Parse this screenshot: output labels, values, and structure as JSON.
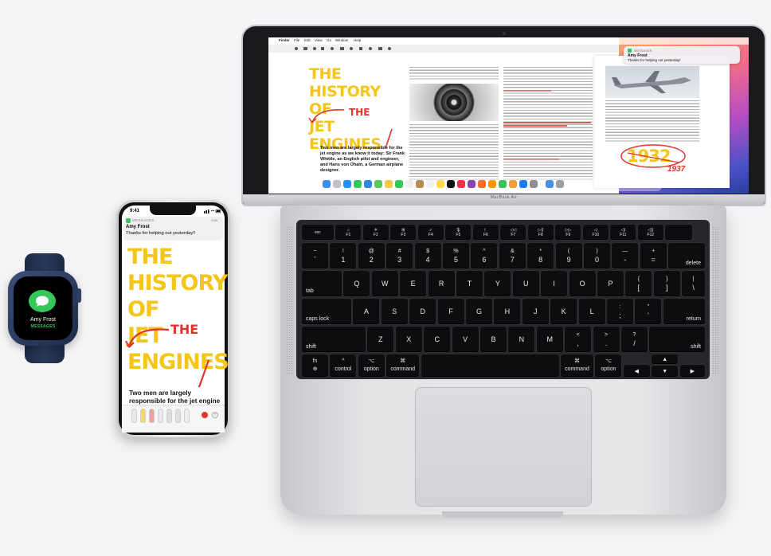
{
  "watch": {
    "contact_name": "Amy Frost",
    "app_label": "MESSAGES",
    "icon": "messages-icon"
  },
  "iphone": {
    "time": "9:41",
    "notification": {
      "app": "MESSAGES",
      "time": "now",
      "sender": "Amy Frost",
      "body": "Thanks for helping out yesterday!!"
    },
    "doc_title_lines": [
      "THE",
      "HISTORY",
      "OF",
      "JET",
      "ENGINES"
    ],
    "annotation": "THE",
    "body_text": "Two men are largely responsible for the jet engine as we know it today: Sir Frank Whittle"
  },
  "macbook": {
    "model_label": "MacBook Air",
    "menubar": [
      "Finder",
      "File",
      "Edit",
      "View",
      "Go",
      "Window",
      "Help"
    ],
    "notification": {
      "app": "MESSAGES",
      "sender": "Amy Frost",
      "body": "Thanks for helping out yesterday!"
    },
    "doc_title_lines": [
      "THE",
      "HISTORY",
      "OF",
      "JET",
      "ENGINES"
    ],
    "doc_annotation": "THE",
    "doc_subtitle": "Two men are largely responsible for the jet engine as we know it today: Sir Frank Whittle, an English pilot and engineer, and Hans von Ohain, a German airplane designer.",
    "year_printed": "1932",
    "year_annotation": "1937",
    "accent_yellow": "#f5c518",
    "accent_red": "#e2342a"
  },
  "keyboard": {
    "row_fn": [
      {
        "top": "esc",
        "bottom": ""
      },
      {
        "top": "☼",
        "bottom": "F1"
      },
      {
        "top": "☀",
        "bottom": "F2"
      },
      {
        "top": "⊞",
        "bottom": "F3"
      },
      {
        "top": "⌕",
        "bottom": "F4"
      },
      {
        "top": "🎙",
        "bottom": "F5"
      },
      {
        "top": "☾",
        "bottom": "F6"
      },
      {
        "top": "◁◁",
        "bottom": "F7"
      },
      {
        "top": "▷||",
        "bottom": "F8"
      },
      {
        "top": "▷▷",
        "bottom": "F9"
      },
      {
        "top": "◁",
        "bottom": "F10"
      },
      {
        "top": "◁)",
        "bottom": "F11"
      },
      {
        "top": "◁))",
        "bottom": "F12"
      },
      {
        "top": "",
        "bottom": ""
      }
    ],
    "row_num": [
      {
        "top": "~",
        "bottom": "`"
      },
      {
        "top": "!",
        "bottom": "1"
      },
      {
        "top": "@",
        "bottom": "2"
      },
      {
        "top": "#",
        "bottom": "3"
      },
      {
        "top": "$",
        "bottom": "4"
      },
      {
        "top": "%",
        "bottom": "5"
      },
      {
        "top": "^",
        "bottom": "6"
      },
      {
        "top": "&",
        "bottom": "7"
      },
      {
        "top": "*",
        "bottom": "8"
      },
      {
        "top": "(",
        "bottom": "9"
      },
      {
        "top": ")",
        "bottom": "0"
      },
      {
        "top": "—",
        "bottom": "-"
      },
      {
        "top": "+",
        "bottom": "="
      }
    ],
    "delete": "delete",
    "tab": "tab",
    "row_q": [
      "Q",
      "W",
      "E",
      "R",
      "T",
      "Y",
      "U",
      "I",
      "O",
      "P"
    ],
    "row_q_extra": [
      {
        "top": "{",
        "bottom": "["
      },
      {
        "top": "}",
        "bottom": "]"
      },
      {
        "top": "|",
        "bottom": "\\"
      }
    ],
    "caps": "caps lock",
    "row_a": [
      "A",
      "S",
      "D",
      "F",
      "G",
      "H",
      "J",
      "K",
      "L"
    ],
    "row_a_extra": [
      {
        "top": ":",
        "bottom": ";"
      },
      {
        "top": "\"",
        "bottom": "'"
      }
    ],
    "return": "return",
    "shift": "shift",
    "row_z": [
      "Z",
      "X",
      "C",
      "V",
      "B",
      "N",
      "M"
    ],
    "row_z_extra": [
      {
        "top": "<",
        "bottom": ","
      },
      {
        "top": ">",
        "bottom": "."
      },
      {
        "top": "?",
        "bottom": "/"
      }
    ],
    "fn": "fn",
    "globe": "⊕",
    "control": "control",
    "control_sym": "^",
    "option": "option",
    "option_sym": "⌥",
    "command": "command",
    "command_sym": "⌘",
    "arrows": {
      "left": "◀",
      "up": "▲",
      "down": "▼",
      "right": "▶"
    }
  }
}
